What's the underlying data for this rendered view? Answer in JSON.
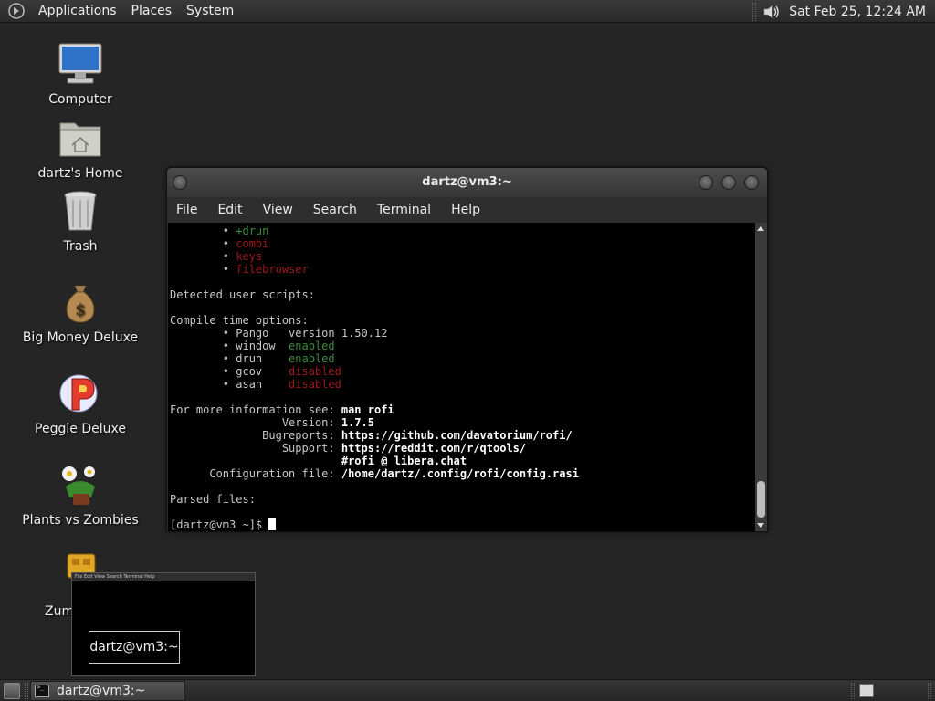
{
  "top_panel": {
    "menus": [
      "Applications",
      "Places",
      "System"
    ],
    "clock": "Sat Feb 25, 12:24 AM",
    "tray_icons": [
      "volume-icon"
    ]
  },
  "desktop": {
    "icons": [
      {
        "label": "Computer",
        "icon": "computer-icon"
      },
      {
        "label": "dartz's Home",
        "icon": "home-folder-icon"
      },
      {
        "label": "Trash",
        "icon": "trash-icon"
      },
      {
        "label": "Big Money Deluxe",
        "icon": "money-bag-icon"
      },
      {
        "label": "Peggle Deluxe",
        "icon": "peggle-icon"
      },
      {
        "label": "Plants vs Zombies",
        "icon": "plants-icon"
      },
      {
        "label": "Zuma",
        "icon": "zuma-icon"
      }
    ]
  },
  "terminal": {
    "title": "dartz@vm3:~",
    "menu": [
      "File",
      "Edit",
      "View",
      "Search",
      "Terminal",
      "Help"
    ],
    "lines": {
      "l1a": "        • ",
      "l1b": "+drun",
      "l2a": "        • ",
      "l2b": "combi",
      "l3a": "        • ",
      "l3b": "keys",
      "l4a": "        • ",
      "l4b": "filebrowser",
      "l6": "Detected user scripts:",
      "l8": "Compile time options:",
      "l9": "        • Pango   version 1.50.12",
      "l10a": "        • window  ",
      "l10b": "enabled",
      "l11a": "        • drun    ",
      "l11b": "enabled",
      "l12a": "        • gcov    ",
      "l12b": "disabled",
      "l13a": "        • asan    ",
      "l13b": "disabled",
      "l15a": "For more information see: ",
      "l15b": "man rofi",
      "l16a": "                 Version: ",
      "l16b": "1.7.5",
      "l17a": "              Bugreports: ",
      "l17b": "https://github.com/davatorium/rofi/",
      "l18a": "                 Support: ",
      "l18b": "https://reddit.com/r/qtools/",
      "l19a": "                          ",
      "l19b": "#rofi @ libera.chat",
      "l20a": "      Configuration file: ",
      "l20b": "/home/dartz/.config/rofi/config.rasi",
      "l22": "Parsed files:",
      "l24": "[dartz@vm3 ~]$ "
    }
  },
  "preview": {
    "tooltip": "dartz@vm3:~",
    "menu": "File  Edit  View  Search  Terminal  Help"
  },
  "taskbar": {
    "task_label": "dartz@vm3:~"
  }
}
